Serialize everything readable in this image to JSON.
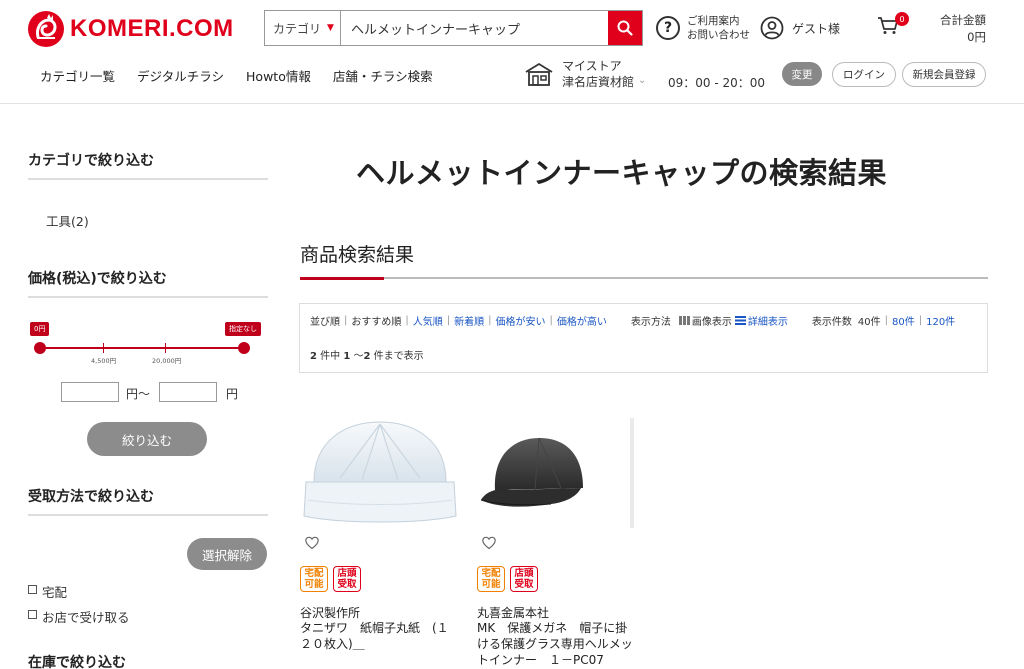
{
  "header": {
    "logo_text": "KOMERI.COM",
    "search": {
      "category_label": "カテゴリ",
      "query": "ヘルメットインナーキャップ"
    },
    "help": {
      "line1": "ご利用案内",
      "line2": "お問い合わせ"
    },
    "guest_label": "ゲスト様",
    "cart_count": "0",
    "total": {
      "label": "合計金額",
      "amount": "0円"
    },
    "nav": [
      "カテゴリ一覧",
      "デジタルチラシ",
      "Howto情報",
      "店舗・チラシ検索"
    ],
    "store": {
      "line1": "マイストア",
      "line2": "津名店資材館",
      "hours": "09：00 - 20：00"
    },
    "buttons": {
      "change": "変更",
      "login": "ログイン",
      "register": "新規会員登録"
    }
  },
  "sidebar": {
    "category": {
      "title": "カテゴリで絞り込む",
      "items": [
        "工具(2)"
      ]
    },
    "price": {
      "title": "価格(税込)で絞り込む",
      "min_tag": "0円",
      "max_tag": "指定なし",
      "tick_labels": [
        "4,500円",
        "20,000円"
      ],
      "unit_from": "円〜",
      "unit_to": "円",
      "submit_label": "絞り込む"
    },
    "pickup": {
      "title": "受取方法で絞り込む",
      "clear_label": "選択解除",
      "options": [
        "宅配",
        "お店で受け取る"
      ]
    },
    "stock": {
      "title": "在庫で絞り込む"
    }
  },
  "main": {
    "title": "ヘルメットインナーキャップの検索結果",
    "subtitle": "商品検索結果",
    "sort": {
      "label": "並び順",
      "options": [
        "おすすめ順",
        "人気順",
        "新着順",
        "価格が安い",
        "価格が高い"
      ],
      "view_label": "表示方法",
      "view_options": [
        "画像表示",
        "詳細表示"
      ],
      "count_label": "表示件数",
      "count_options": [
        "40件",
        "80件",
        "120件"
      ]
    },
    "result_count": {
      "total": "2",
      "from": "1",
      "to": "2",
      "text_pre": "件中",
      "text_mid": "〜",
      "text_post": "件まで表示"
    },
    "products": [
      {
        "badges": [
          "宅配\n可能",
          "店頭\n受取"
        ],
        "maker": "谷沢製作所",
        "name": "タニザワ　紙帽子丸紙　(１２０枚入)＿"
      },
      {
        "badges": [
          "宅配\n可能",
          "店頭\n受取"
        ],
        "maker": "丸喜金属本社",
        "name": "MK　保護メガネ　帽子に掛ける保護グラス専用ヘルメットインナー　１－PC07"
      }
    ]
  },
  "colors": {
    "brand_red": "#e0001b",
    "link_blue": "#1a56c4",
    "badge_orange": "#f08000"
  }
}
